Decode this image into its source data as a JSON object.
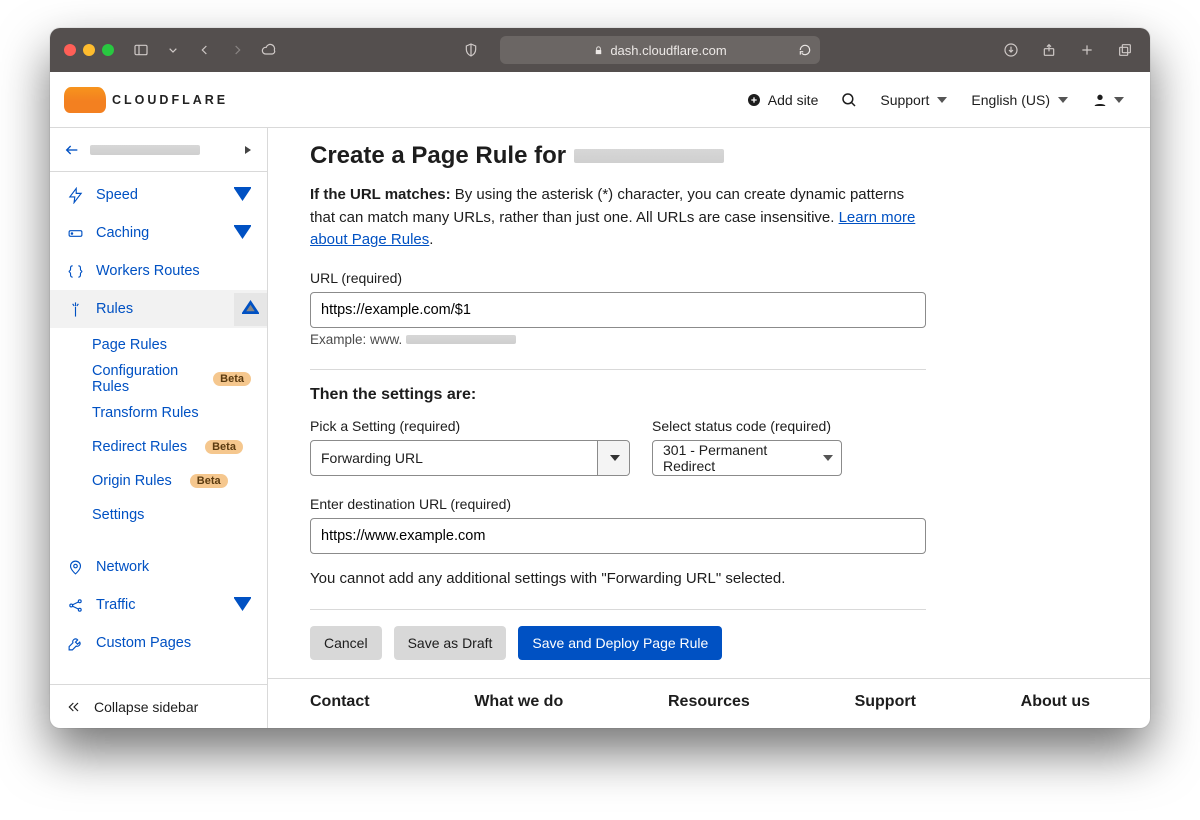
{
  "browser": {
    "url_host": "dash.cloudflare.com"
  },
  "header": {
    "logo_word": "CLOUDFLARE",
    "add_site": "Add site",
    "support": "Support",
    "language": "English (US)"
  },
  "sidebar": {
    "items": [
      {
        "label": "Speed",
        "icon": "bolt",
        "chev": true
      },
      {
        "label": "Caching",
        "icon": "drive",
        "chev": true
      },
      {
        "label": "Workers Routes",
        "icon": "braces",
        "chev": false
      },
      {
        "label": "Rules",
        "icon": "wand",
        "chev": true,
        "active": true,
        "children": [
          {
            "label": "Page Rules"
          },
          {
            "label": "Configuration Rules",
            "badge": "Beta"
          },
          {
            "label": "Transform Rules"
          },
          {
            "label": "Redirect Rules",
            "badge": "Beta"
          },
          {
            "label": "Origin Rules",
            "badge": "Beta"
          },
          {
            "label": "Settings"
          }
        ]
      },
      {
        "label": "Network",
        "icon": "pin",
        "chev": false
      },
      {
        "label": "Traffic",
        "icon": "share",
        "chev": true
      },
      {
        "label": "Custom Pages",
        "icon": "wrench",
        "chev": false
      }
    ],
    "collapse": "Collapse sidebar"
  },
  "page": {
    "title": "Create a Page Rule for",
    "intro_bold": "If the URL matches:",
    "intro_rest": " By using the asterisk (*) character, you can create dynamic patterns that can match many URLs, rather than just one. All URLs are case insensitive. ",
    "intro_link": "Learn more about Page Rules",
    "period": ".",
    "url_label": "URL (required)",
    "url_value": "https://example.com/$1",
    "example_prefix": "Example: www.",
    "settings_heading": "Then the settings are:",
    "setting_label": "Pick a Setting (required)",
    "setting_value": "Forwarding URL",
    "status_label": "Select status code (required)",
    "status_value": "301 - Permanent Redirect",
    "dest_label": "Enter destination URL (required)",
    "dest_value": "https://www.example.com",
    "note": "You cannot add any additional settings with \"Forwarding URL\" selected.",
    "buttons": {
      "cancel": "Cancel",
      "draft": "Save as Draft",
      "deploy": "Save and Deploy Page Rule"
    }
  },
  "footer": [
    "Contact",
    "What we do",
    "Resources",
    "Support",
    "About us"
  ]
}
